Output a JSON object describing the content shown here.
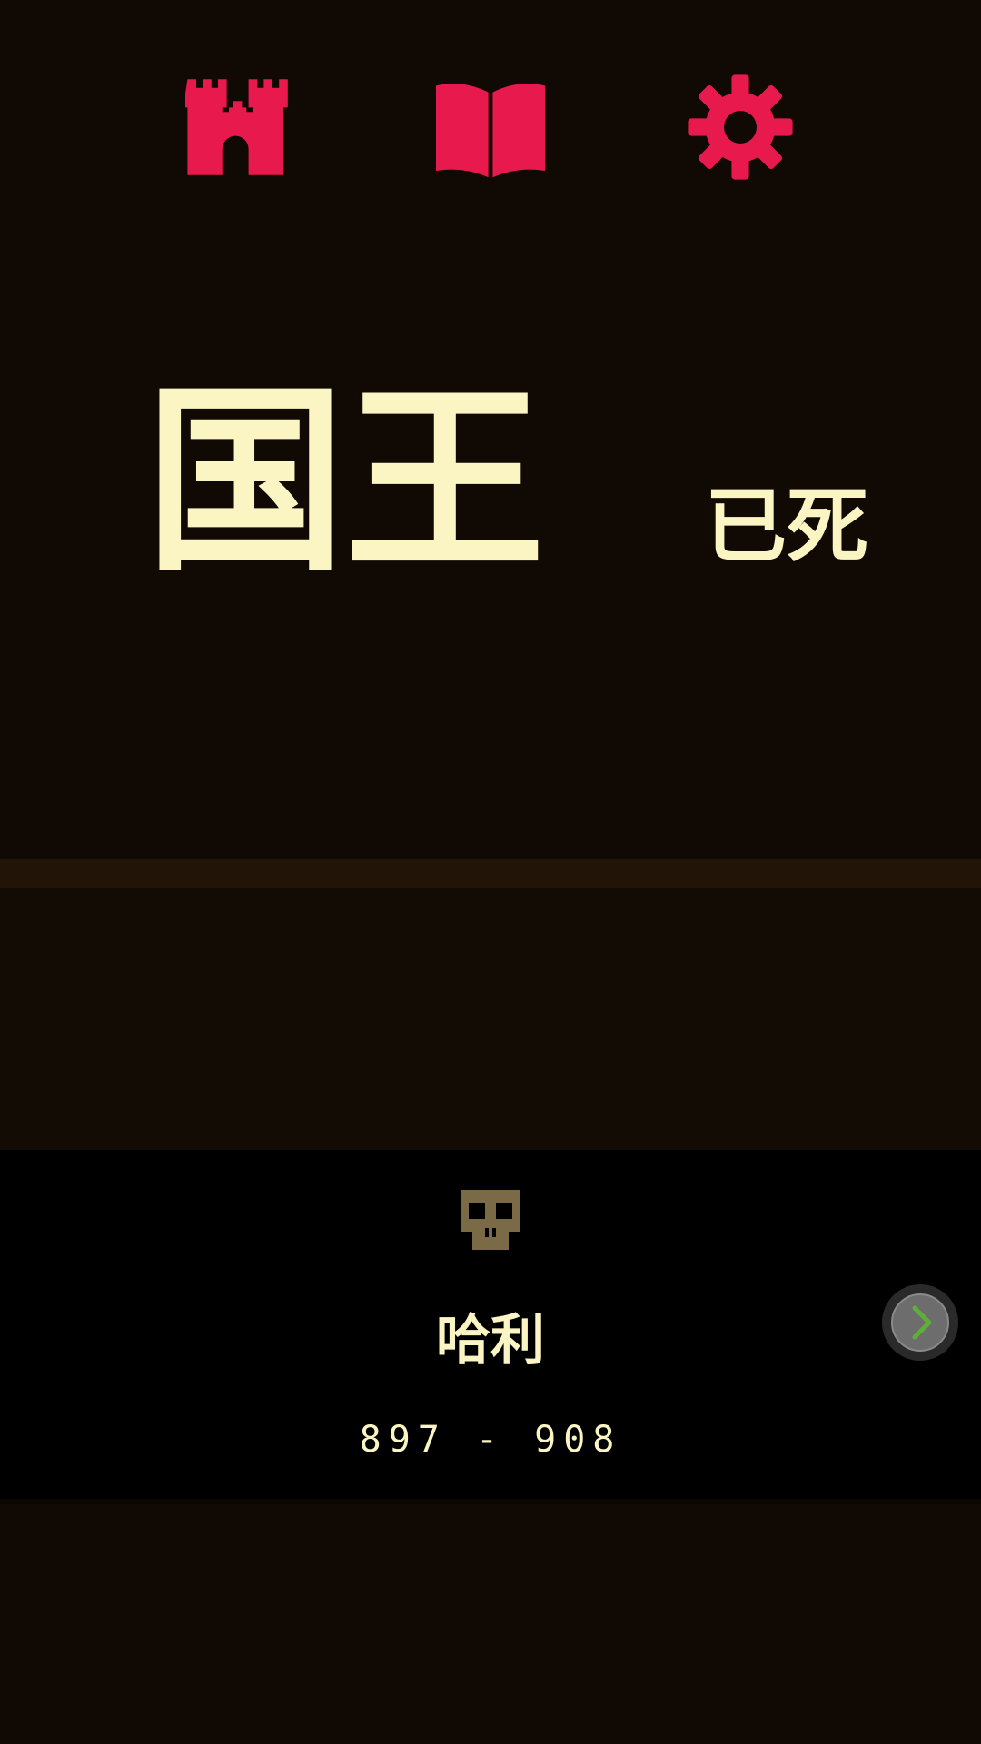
{
  "header": {
    "icons": [
      "castle-icon",
      "book-icon",
      "gear-icon"
    ],
    "accent_color": "#e8194c"
  },
  "title": {
    "main": "国王",
    "sub": "已死"
  },
  "panel": {
    "icon": "skull-icon",
    "king_name": "哈利",
    "reign": "897 - 908",
    "next_icon": "chevron-right-icon"
  },
  "colors": {
    "background": "#110903",
    "text": "#fbf5c3",
    "skull": "#7a6a46",
    "chevron": "#5fae3a"
  }
}
